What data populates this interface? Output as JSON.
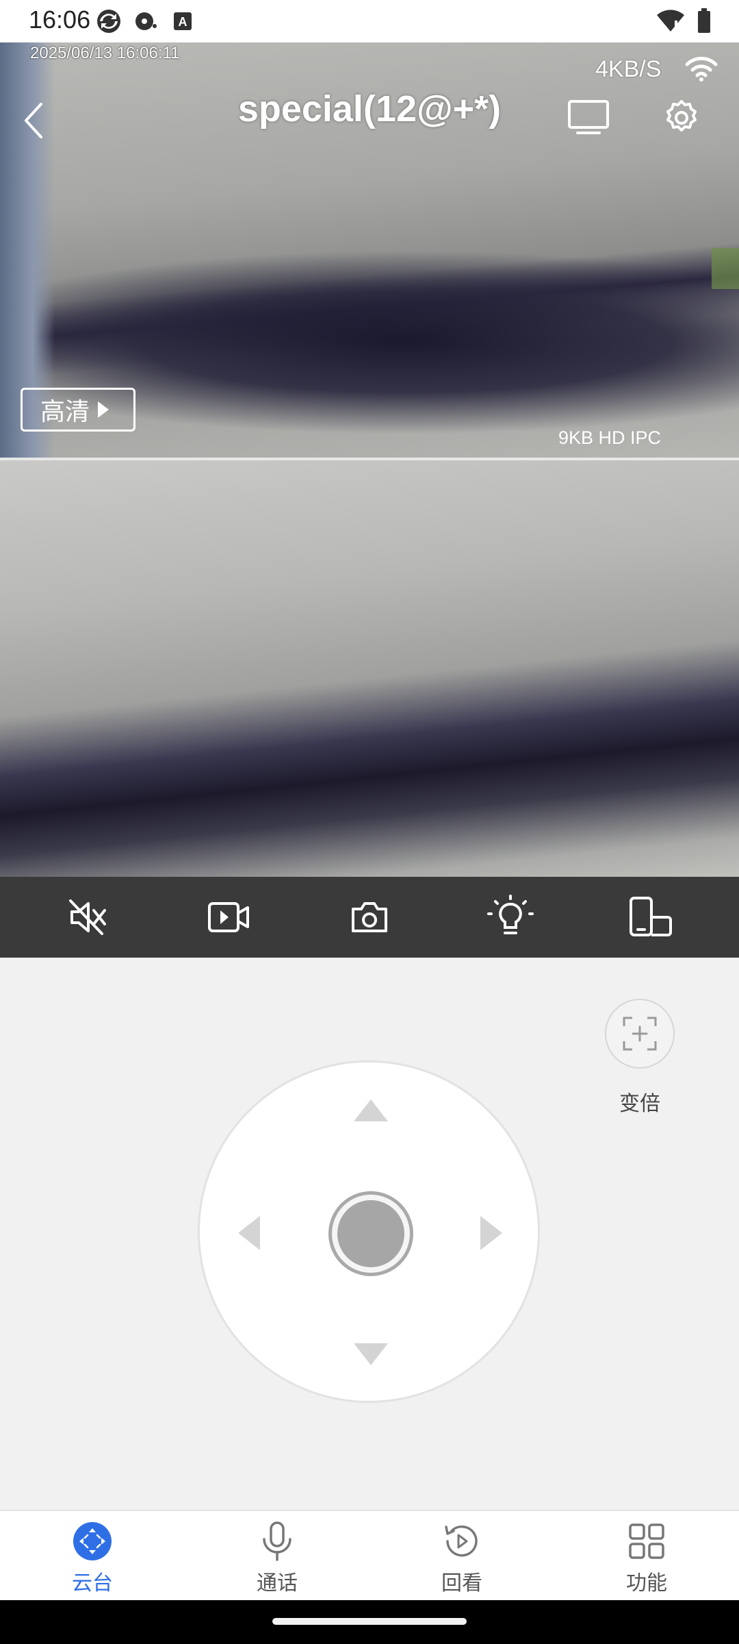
{
  "status_bar": {
    "time": "16:06",
    "icons": [
      "sync-icon",
      "media-icon",
      "keyboard-icon",
      "wifi-icon",
      "battery-icon"
    ]
  },
  "video": {
    "timestamp": "2025/06/13 16:06:11",
    "net_speed": "4KB/S",
    "device_title": "special(12@+*)",
    "quality_label": "高清",
    "stream_info": "9KB HD IPC"
  },
  "toolbar": {
    "items": [
      "mute-icon",
      "record-icon",
      "snapshot-icon",
      "light-icon",
      "phone-layout-icon"
    ]
  },
  "control": {
    "zoom_label": "变倍"
  },
  "tabs": [
    {
      "label": "云台",
      "icon": "ptz-icon",
      "active": true
    },
    {
      "label": "通话",
      "icon": "microphone-icon",
      "active": false
    },
    {
      "label": "回看",
      "icon": "playback-icon",
      "active": false
    },
    {
      "label": "功能",
      "icon": "grid-icon",
      "active": false
    }
  ],
  "colors": {
    "accent": "#2f6fe6",
    "toolbar_bg": "#3a3a3a",
    "control_bg": "#f1f1f1"
  }
}
